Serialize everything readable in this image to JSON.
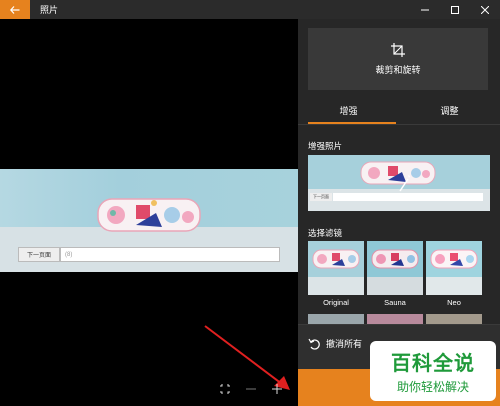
{
  "titlebar": {
    "title": "照片",
    "back_icon": "back-arrow-icon",
    "accent": "#e6821e"
  },
  "canvas": {
    "photo": {
      "prev_page_label": "下一页面",
      "search_placeholder": "(8)"
    }
  },
  "panel": {
    "crop_rotate_label": "裁剪和旋转",
    "tabs": [
      {
        "label": "增强",
        "active": true
      },
      {
        "label": "调整",
        "active": false
      }
    ],
    "enhance_label": "增强照片",
    "filters_label": "选择滤镜",
    "filters": [
      {
        "name": "Original",
        "selected": true
      },
      {
        "name": "Sauna",
        "selected": false
      },
      {
        "name": "Neo",
        "selected": false
      }
    ],
    "undo_label": "撤消所有"
  },
  "watermark": {
    "main": "百科全说",
    "sub": "助你轻松解决"
  }
}
